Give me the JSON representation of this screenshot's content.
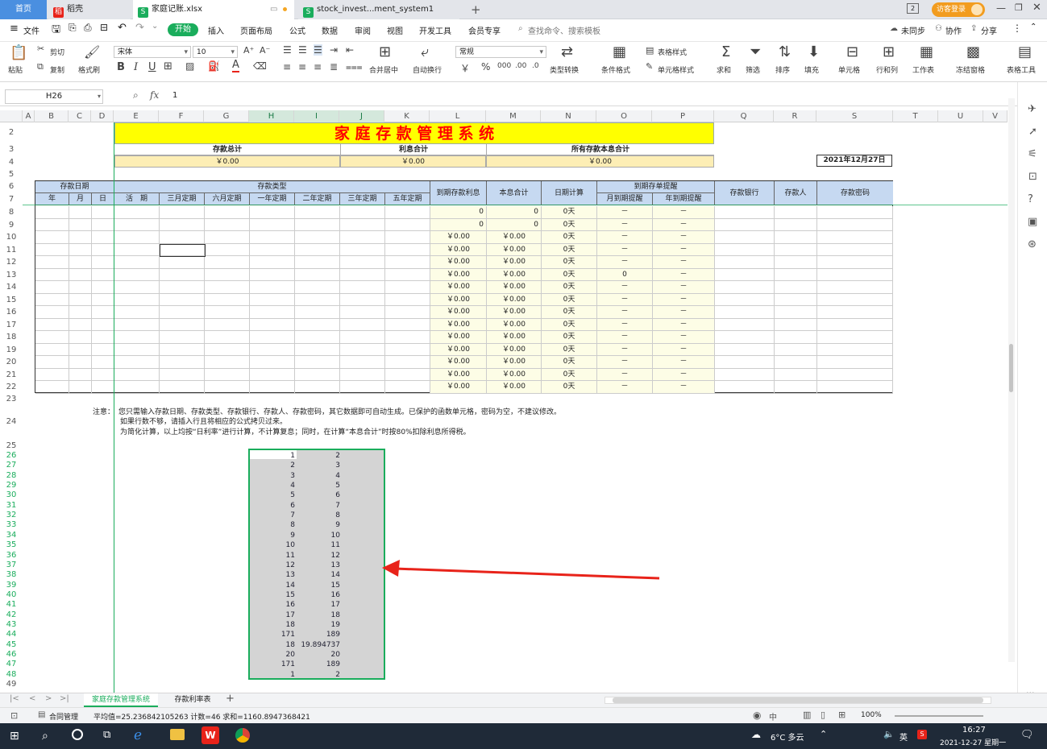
{
  "tabs": [
    {
      "label": "首页"
    },
    {
      "label": "稻壳"
    },
    {
      "label": "家庭记账.xlsx"
    },
    {
      "label": "stock_invest...ment_system1"
    }
  ],
  "login_label": "访客登录",
  "menu": [
    "文件",
    "开始",
    "插入",
    "页面布局",
    "公式",
    "数据",
    "审阅",
    "视图",
    "开发工具",
    "会员专享"
  ],
  "search_placeholder": "查找命令、搜索模板",
  "menu_right": [
    "未同步",
    "协作",
    "分享"
  ],
  "ribbon": {
    "paste": "粘贴",
    "cut": "剪切",
    "copy": "复制",
    "format_painter": "格式刷",
    "font_name": "宋体",
    "font_size": "10",
    "number_format": "常规",
    "merge": "合并居中",
    "wrap": "自动换行",
    "type_convert": "类型转换",
    "cond_format": "条件格式",
    "table_style": "表格样式",
    "cell_style": "单元格样式",
    "sum": "求和",
    "filter": "筛选",
    "sort": "排序",
    "fill": "填充",
    "cells": "单元格",
    "row_col": "行和列",
    "worksheet": "工作表",
    "freeze": "冻结窗格",
    "tools": "表格工具"
  },
  "formula_bar": {
    "name_box": "H26",
    "fx": "fx",
    "content": "1"
  },
  "columns": [
    "A",
    "B",
    "C",
    "D",
    "E",
    "F",
    "G",
    "H",
    "I",
    "J",
    "K",
    "L",
    "M",
    "N",
    "O",
    "P",
    "Q",
    "R",
    "S",
    "T",
    "U",
    "V"
  ],
  "rows": [
    "2",
    "3",
    "4",
    "5",
    "6",
    "7",
    "8",
    "9",
    "10",
    "11",
    "12",
    "13",
    "14",
    "15",
    "16",
    "17",
    "18",
    "19",
    "20",
    "21",
    "22",
    "23",
    "24",
    "25",
    "26",
    "27",
    "28",
    "29",
    "30",
    "31",
    "32",
    "33",
    "34",
    "35",
    "36",
    "37",
    "38",
    "39",
    "40",
    "41",
    "42",
    "43",
    "44",
    "45",
    "46",
    "47",
    "48",
    "49"
  ],
  "sheet": {
    "title": "家 庭 存 款 管 理 系 统",
    "summary_labels": [
      "存款总计",
      "利息合计",
      "所有存款本息合计"
    ],
    "summary_values": [
      "￥0.00",
      "￥0.00",
      "￥0.00"
    ],
    "date": "2021年12月27日",
    "headers": {
      "deposit_date": "存款日期",
      "year": "年",
      "month": "月",
      "day": "日",
      "deposit_type": "存款类型",
      "types": [
        "活　期",
        "三月定期",
        "六月定期",
        "一年定期",
        "二年定期",
        "三年定期",
        "五年定期"
      ],
      "interest": "到期存款利息",
      "total": "本息合计",
      "days": "日期计算",
      "reminder": "到期存单提醒",
      "month_reminder": "月到期提醒",
      "year_reminder": "年到期提醒",
      "bank": "存款银行",
      "person": "存款人",
      "password": "存款密码"
    },
    "data_rows": [
      {
        "interest": "0",
        "total": "0",
        "days": "0天",
        "m": "－",
        "y": "－"
      },
      {
        "interest": "0",
        "total": "0",
        "days": "0天",
        "m": "－",
        "y": "－"
      },
      {
        "interest": "￥0.00",
        "total": "￥0.00",
        "days": "0天",
        "m": "－",
        "y": "－"
      },
      {
        "interest": "￥0.00",
        "total": "￥0.00",
        "days": "0天",
        "m": "－",
        "y": "－"
      },
      {
        "interest": "￥0.00",
        "total": "￥0.00",
        "days": "0天",
        "m": "－",
        "y": "－"
      },
      {
        "interest": "￥0.00",
        "total": "￥0.00",
        "days": "0天",
        "m": "0",
        "y": "－"
      },
      {
        "interest": "￥0.00",
        "total": "￥0.00",
        "days": "0天",
        "m": "－",
        "y": "－"
      },
      {
        "interest": "￥0.00",
        "total": "￥0.00",
        "days": "0天",
        "m": "－",
        "y": "－"
      },
      {
        "interest": "￥0.00",
        "total": "￥0.00",
        "days": "0天",
        "m": "－",
        "y": "－"
      },
      {
        "interest": "￥0.00",
        "total": "￥0.00",
        "days": "0天",
        "m": "－",
        "y": "－"
      },
      {
        "interest": "￥0.00",
        "total": "￥0.00",
        "days": "0天",
        "m": "－",
        "y": "－"
      },
      {
        "interest": "￥0.00",
        "total": "￥0.00",
        "days": "0天",
        "m": "－",
        "y": "－"
      },
      {
        "interest": "￥0.00",
        "total": "￥0.00",
        "days": "0天",
        "m": "－",
        "y": "－"
      },
      {
        "interest": "￥0.00",
        "total": "￥0.00",
        "days": "0天",
        "m": "－",
        "y": "－"
      },
      {
        "interest": "￥0.00",
        "total": "￥0.00",
        "days": "0天",
        "m": "－",
        "y": "－"
      }
    ],
    "note_label": "注意：",
    "notes": [
      "您只需输入存款日期、存款类型、存款银行、存款人、存款密码，其它数据即可自动生成。已保护的函数单元格，密码为空，不建议修改。",
      "如果行数不够，请插入行且将相应的公式拷贝过来。",
      "为简化计算，以上均按“日利率”进行计算，不计算复息；同时，在计算“本息合计”时按80%扣除利息所得税。"
    ],
    "selection_values": [
      [
        "1",
        "2"
      ],
      [
        "2",
        "3"
      ],
      [
        "3",
        "4"
      ],
      [
        "4",
        "5"
      ],
      [
        "5",
        "6"
      ],
      [
        "6",
        "7"
      ],
      [
        "7",
        "8"
      ],
      [
        "8",
        "9"
      ],
      [
        "9",
        "10"
      ],
      [
        "10",
        "11"
      ],
      [
        "11",
        "12"
      ],
      [
        "12",
        "13"
      ],
      [
        "13",
        "14"
      ],
      [
        "14",
        "15"
      ],
      [
        "15",
        "16"
      ],
      [
        "16",
        "17"
      ],
      [
        "17",
        "18"
      ],
      [
        "18",
        "19"
      ],
      [
        "171",
        "189"
      ],
      [
        "18",
        "19.894737"
      ],
      [
        "20",
        "20"
      ],
      [
        "171",
        "189"
      ],
      [
        "1",
        "2"
      ]
    ]
  },
  "sheet_tabs": [
    "家庭存款管理系统",
    "存款利率表"
  ],
  "status": {
    "contract": "合同管理",
    "stats": "平均值=25.236842105263  计数=46  求和=1160.8947368421",
    "zoom": "100%"
  },
  "taskbar": {
    "weather": "6°C 多云",
    "ime": "英",
    "time": "16:27",
    "date": "2021-12-27 星期一"
  },
  "colors": {
    "title_bg": "#ffff00",
    "title_fg": "#ff0000",
    "header_bg": "#c6d9f1",
    "summary_bg": "#fdeeb5",
    "calc_bg": "#fdfde6",
    "selection": "#d4d4d4",
    "accent": "#1aad5c",
    "arrow": "#e8231a"
  }
}
